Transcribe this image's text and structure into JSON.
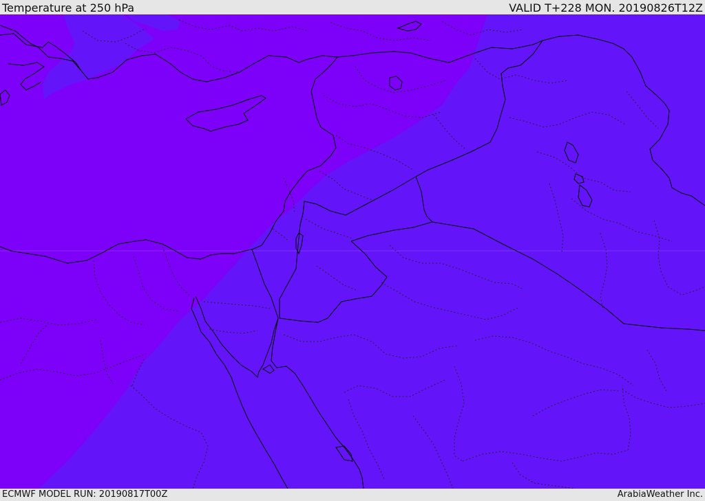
{
  "header": {
    "title": "Temperature at 250 hPa",
    "valid_time": "VALID T+228 MON. 20190826T12Z"
  },
  "footer": {
    "model_run": "ECMWF MODEL RUN: 20190817T00Z",
    "credit": "ArabiaWeather Inc."
  },
  "colors": {
    "warm_band": "#7d00f8",
    "cool_band": "#6414f9",
    "border_line": "#000000",
    "admin_line": "#222222",
    "bar_background": "#e6e6e6"
  }
}
